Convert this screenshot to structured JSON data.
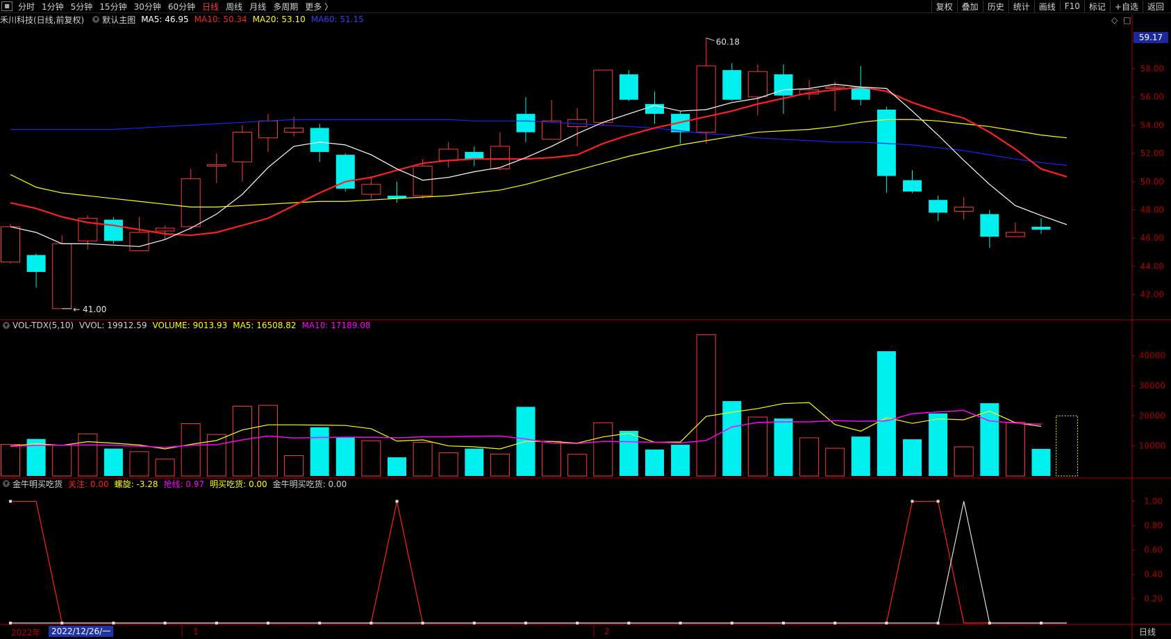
{
  "toolbar": {
    "window_icon": "■",
    "periods": [
      "分时",
      "1分钟",
      "5分钟",
      "15分钟",
      "30分钟",
      "60分钟",
      "日线",
      "周线",
      "月线",
      "多周期",
      "更多 〉"
    ],
    "active_index": 6,
    "actions": [
      "复权",
      "叠加",
      "历史",
      "统计",
      "画线",
      "F10",
      "标记",
      "+自选",
      "返回"
    ]
  },
  "main_panel": {
    "stock": "禾川科技(日线,前复权)",
    "template": "默认主图",
    "ma5_label": "MA5: 46.95",
    "ma10_label": "MA10: 50.34",
    "ma20_label": "MA20: 53.10",
    "ma60_label": "MA60: 51.15",
    "current_price_tag": "59.17",
    "high_label": "60.18",
    "low_label": "41.00",
    "icons": [
      "◇",
      "□"
    ]
  },
  "vol_panel": {
    "name": "VOL-TDX(5,10)",
    "vvol": "VVOL: 19912.59",
    "volume": "VOLUME: 9013.93",
    "ma5": "MA5: 16508.82",
    "ma10": "MA10: 17189.08"
  },
  "ind_panel": {
    "name": "金牛明买吃货",
    "attn": "关注: 0.00",
    "spiral": "螺旋: -3.28",
    "grab": "抢线: 0.97",
    "buy": "明买吃货: 0.00",
    "main": "金牛明买吃货: 0.00"
  },
  "bottom_axis": {
    "year": "2022年",
    "date_tag": "2022/12/26/一",
    "month1": "1",
    "month2": "2",
    "corner": "日线"
  },
  "colors": {
    "up": "#ff3b3b",
    "down": "#00f0f0",
    "ma5": "#ffffff",
    "ma10": "#ff2020",
    "ma20": "#ffff00",
    "ma60": "#2020ff",
    "vvol": "#ffff00",
    "vol_ma10": "#ff00ff",
    "axis": "#b00000"
  },
  "chart_data": {
    "type": "candlestick",
    "price_axis": {
      "ticks": [
        "60.00",
        "58.00",
        "56.00",
        "54.00",
        "52.00",
        "50.00",
        "48.00",
        "46.00",
        "44.00",
        "42.00"
      ],
      "range": [
        40.5,
        61
      ]
    },
    "volume_axis": {
      "ticks": [
        "40000",
        "30000",
        "20000",
        "10000"
      ],
      "range": [
        0,
        48000
      ]
    },
    "indicator_axis": {
      "ticks": [
        "1.00",
        "0.80",
        "0.60",
        "0.40",
        "0.20"
      ],
      "range": [
        0,
        1.1
      ]
    },
    "candles": [
      {
        "o": 44.3,
        "c": 46.8,
        "h": 47.0,
        "l": 44.2
      },
      {
        "o": 44.8,
        "c": 43.6,
        "h": 44.9,
        "l": 42.5
      },
      {
        "o": 41.0,
        "c": 45.6,
        "h": 46.2,
        "l": 41.0
      },
      {
        "o": 45.8,
        "c": 47.4,
        "h": 47.6,
        "l": 45.2
      },
      {
        "o": 47.3,
        "c": 45.8,
        "h": 47.5,
        "l": 45.6
      },
      {
        "o": 45.1,
        "c": 46.4,
        "h": 47.5,
        "l": 45.1
      },
      {
        "o": 46.5,
        "c": 46.7,
        "h": 46.9,
        "l": 45.9
      },
      {
        "o": 46.8,
        "c": 50.2,
        "h": 50.9,
        "l": 46.6
      },
      {
        "o": 51.1,
        "c": 51.2,
        "h": 52.0,
        "l": 49.9
      },
      {
        "o": 51.4,
        "c": 53.5,
        "h": 54.0,
        "l": 50.0
      },
      {
        "o": 53.1,
        "c": 54.3,
        "h": 54.8,
        "l": 52.1
      },
      {
        "o": 53.5,
        "c": 53.8,
        "h": 54.6,
        "l": 53.2
      },
      {
        "o": 53.8,
        "c": 52.1,
        "h": 54.1,
        "l": 51.4
      },
      {
        "o": 51.9,
        "c": 49.5,
        "h": 52.0,
        "l": 49.3
      },
      {
        "o": 49.1,
        "c": 49.8,
        "h": 50.4,
        "l": 48.8
      },
      {
        "o": 49.0,
        "c": 48.8,
        "h": 50.0,
        "l": 48.5
      },
      {
        "o": 49.0,
        "c": 51.1,
        "h": 51.6,
        "l": 48.8
      },
      {
        "o": 51.5,
        "c": 52.3,
        "h": 52.8,
        "l": 51.0
      },
      {
        "o": 52.1,
        "c": 51.6,
        "h": 52.5,
        "l": 51.1
      },
      {
        "o": 50.9,
        "c": 52.5,
        "h": 53.5,
        "l": 50.8
      },
      {
        "o": 54.8,
        "c": 53.5,
        "h": 56.0,
        "l": 52.8
      },
      {
        "o": 53.0,
        "c": 54.3,
        "h": 55.8,
        "l": 53.0
      },
      {
        "o": 53.9,
        "c": 54.4,
        "h": 55.2,
        "l": 52.5
      },
      {
        "o": 54.2,
        "c": 57.9,
        "h": 57.9,
        "l": 54.0
      },
      {
        "o": 57.6,
        "c": 55.8,
        "h": 57.9,
        "l": 55.7
      },
      {
        "o": 55.5,
        "c": 54.8,
        "h": 56.4,
        "l": 54.1
      },
      {
        "o": 54.8,
        "c": 53.5,
        "h": 55.0,
        "l": 52.7
      },
      {
        "o": 53.5,
        "c": 58.2,
        "h": 60.18,
        "l": 52.7
      },
      {
        "o": 57.9,
        "c": 55.8,
        "h": 58.4,
        "l": 55.7
      },
      {
        "o": 56.0,
        "c": 57.8,
        "h": 58.3,
        "l": 54.7
      },
      {
        "o": 57.6,
        "c": 56.1,
        "h": 58.3,
        "l": 54.8
      },
      {
        "o": 56.2,
        "c": 56.5,
        "h": 57.2,
        "l": 55.8
      },
      {
        "o": 56.6,
        "c": 56.7,
        "h": 57.1,
        "l": 55.0
      },
      {
        "o": 56.7,
        "c": 55.8,
        "h": 58.2,
        "l": 55.4
      },
      {
        "o": 55.1,
        "c": 50.4,
        "h": 55.3,
        "l": 49.2
      },
      {
        "o": 50.1,
        "c": 49.3,
        "h": 50.8,
        "l": 49.2
      },
      {
        "o": 48.7,
        "c": 47.8,
        "h": 49.0,
        "l": 47.2
      },
      {
        "o": 47.9,
        "c": 48.2,
        "h": 48.9,
        "l": 47.3
      },
      {
        "o": 47.7,
        "c": 46.1,
        "h": 48.0,
        "l": 45.3
      },
      {
        "o": 46.1,
        "c": 46.4,
        "h": 47.1,
        "l": 46.1
      },
      {
        "o": 46.8,
        "c": 46.6,
        "h": 47.4,
        "l": 46.3
      }
    ],
    "ma5": [
      46.8,
      46.4,
      45.6,
      45.6,
      45.5,
      45.4,
      45.9,
      46.7,
      47.7,
      49.1,
      51.0,
      52.5,
      52.8,
      52.6,
      51.9,
      50.9,
      50.1,
      50.3,
      50.7,
      51.0,
      51.7,
      52.5,
      53.4,
      54.2,
      54.8,
      55.4,
      55.0,
      55.1,
      55.6,
      55.9,
      56.5,
      56.6,
      56.9,
      56.7,
      56.6,
      55.0,
      53.3,
      51.5,
      49.8,
      48.3,
      47.6,
      46.95
    ],
    "ma10": [
      48.5,
      48.1,
      47.5,
      47.1,
      46.9,
      46.6,
      46.3,
      46.2,
      46.4,
      46.9,
      47.4,
      48.3,
      49.2,
      50.0,
      50.3,
      50.8,
      51.3,
      51.5,
      51.6,
      51.6,
      51.6,
      51.7,
      51.9,
      52.7,
      53.3,
      53.8,
      54.2,
      54.6,
      55.0,
      55.5,
      55.9,
      56.3,
      56.5,
      56.7,
      56.4,
      55.6,
      55.0,
      54.5,
      53.5,
      52.3,
      50.9,
      50.34
    ],
    "ma20": [
      50.5,
      49.6,
      49.2,
      49.0,
      48.8,
      48.6,
      48.4,
      48.2,
      48.2,
      48.3,
      48.4,
      48.5,
      48.6,
      48.6,
      48.7,
      48.8,
      48.9,
      49.0,
      49.2,
      49.4,
      49.8,
      50.3,
      50.8,
      51.3,
      51.8,
      52.2,
      52.6,
      52.9,
      53.2,
      53.5,
      53.6,
      53.7,
      53.9,
      54.2,
      54.4,
      54.4,
      54.3,
      54.1,
      53.9,
      53.6,
      53.3,
      53.1
    ],
    "ma60": [
      53.7,
      53.7,
      53.7,
      53.7,
      53.7,
      53.8,
      53.9,
      54.0,
      54.1,
      54.2,
      54.3,
      54.4,
      54.4,
      54.4,
      54.4,
      54.4,
      54.4,
      54.4,
      54.3,
      54.3,
      54.3,
      54.2,
      54.1,
      54.0,
      53.9,
      53.8,
      53.6,
      53.4,
      53.3,
      53.1,
      53.0,
      52.9,
      52.8,
      52.8,
      52.7,
      52.6,
      52.4,
      52.2,
      51.9,
      51.6,
      51.35,
      51.15
    ],
    "volumes": [
      10500,
      12300,
      10200,
      14000,
      9100,
      8100,
      5600,
      17400,
      13800,
      23200,
      23500,
      6800,
      16200,
      13000,
      11700,
      6200,
      11200,
      7700,
      9100,
      7300,
      23000,
      11500,
      7200,
      17700,
      15000,
      8800,
      10400,
      47000,
      24900,
      19600,
      19100,
      12700,
      9200,
      13100,
      41500,
      12200,
      20800,
      9700,
      24200,
      17900,
      9000
    ],
    "vvol": [
      10000,
      10700,
      10200,
      11400,
      10900,
      10300,
      9000,
      10500,
      11800,
      15300,
      17000,
      17000,
      16900,
      16800,
      15700,
      11600,
      12000,
      10000,
      9700,
      9000,
      11500,
      11500,
      10900,
      13000,
      14200,
      11200,
      11300,
      19800,
      21200,
      22400,
      24100,
      24400,
      17100,
      14900,
      19400,
      17500,
      19000,
      18700,
      21600,
      17700,
      16500
    ],
    "vol_ma10": [
      9800,
      10200,
      10200,
      10300,
      10200,
      9900,
      9500,
      10200,
      10400,
      12000,
      13300,
      12600,
      12800,
      12900,
      12900,
      12700,
      13000,
      13000,
      13200,
      13300,
      12300,
      11000,
      10800,
      11500,
      11400,
      11200,
      11000,
      11800,
      16300,
      17800,
      18000,
      18000,
      18400,
      18200,
      18300,
      20700,
      21300,
      21800,
      18300,
      17600,
      17200
    ]
  }
}
